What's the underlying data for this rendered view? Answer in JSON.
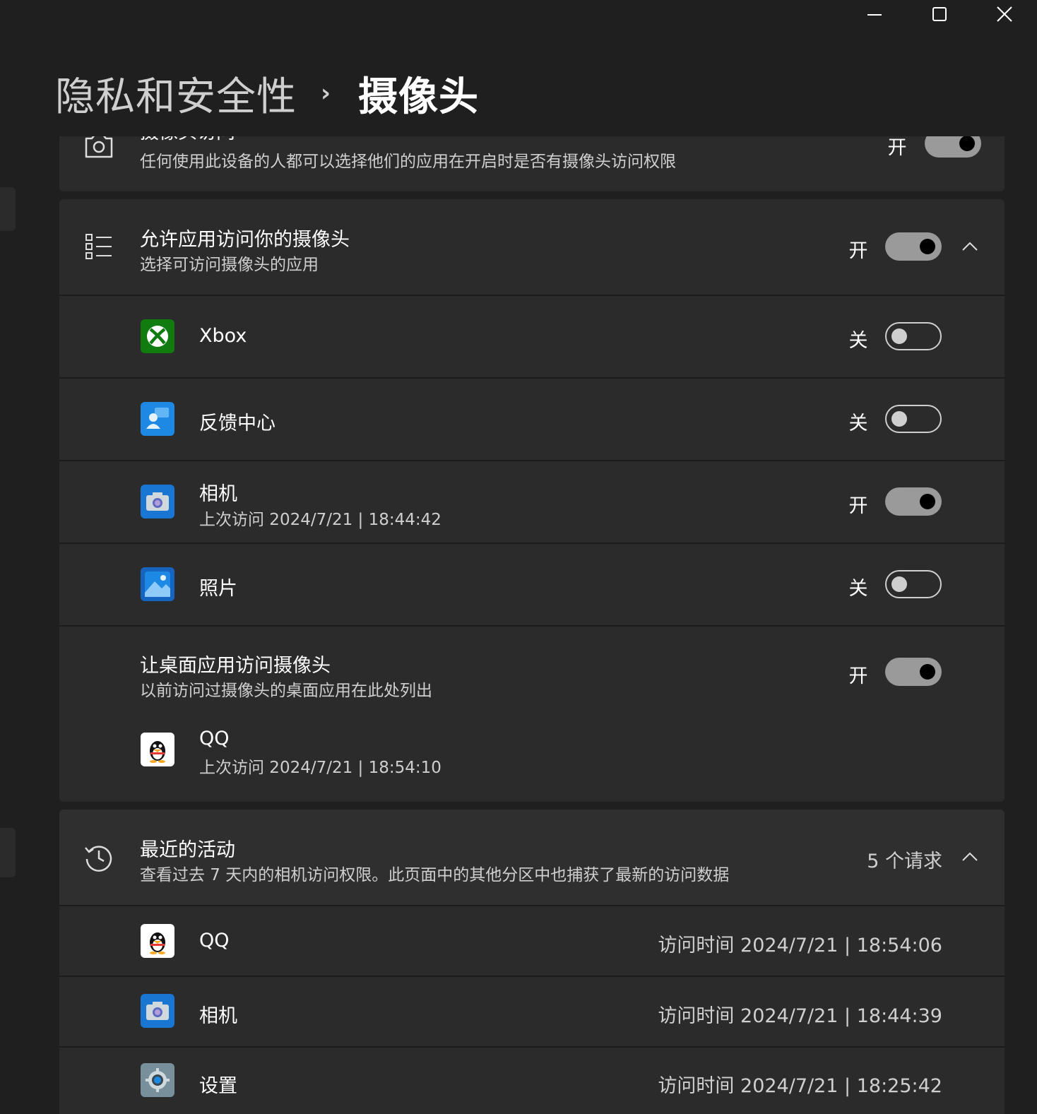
{
  "window_controls": {
    "minimize": "minimize-icon",
    "maximize": "maximize-icon",
    "close": "close-icon"
  },
  "breadcrumb": {
    "parent": "隐私和安全性",
    "separator": "›",
    "current": "摄像头"
  },
  "camera_access": {
    "title": "摄像头访问",
    "description": "任何使用此设备的人都可以选择他们的应用在开启时是否有摄像头访问权限",
    "state_label": "开",
    "toggle_on": true
  },
  "allow_apps": {
    "title": "允许应用访问你的摄像头",
    "description": "选择可访问摄像头的应用",
    "state_label": "开",
    "toggle_on": true,
    "expanded": true
  },
  "apps": [
    {
      "name": "Xbox",
      "last_access": "",
      "state_label": "关",
      "toggle_on": false,
      "icon": "xbox-icon"
    },
    {
      "name": "反馈中心",
      "last_access": "",
      "state_label": "关",
      "toggle_on": false,
      "icon": "feedback-hub-icon"
    },
    {
      "name": "相机",
      "last_access": "上次访问 2024/7/21  |  18:44:42",
      "state_label": "开",
      "toggle_on": true,
      "icon": "camera-app-icon"
    },
    {
      "name": "照片",
      "last_access": "",
      "state_label": "关",
      "toggle_on": false,
      "icon": "photos-icon"
    }
  ],
  "desktop_apps": {
    "title": "让桌面应用访问摄像头",
    "description": "以前访问过摄像头的桌面应用在此处列出",
    "state_label": "开",
    "toggle_on": true,
    "items": [
      {
        "name": "QQ",
        "last_access": "上次访问 2024/7/21  |  18:54:10",
        "icon": "qq-icon"
      }
    ]
  },
  "recent_activity": {
    "title": "最近的活动",
    "description": "查看过去 7 天内的相机访问权限。此页面中的其他分区中也捕获了最新的访问数据",
    "count_label": "5 个请求",
    "expanded": true,
    "items": [
      {
        "name": "QQ",
        "time": "访问时间 2024/7/21 | 18:54:06",
        "icon": "qq-icon"
      },
      {
        "name": "相机",
        "time": "访问时间 2024/7/21 | 18:44:39",
        "icon": "camera-app-icon"
      },
      {
        "name": "设置",
        "time": "访问时间 2024/7/21 | 18:25:42",
        "icon": "settings-icon"
      }
    ]
  }
}
